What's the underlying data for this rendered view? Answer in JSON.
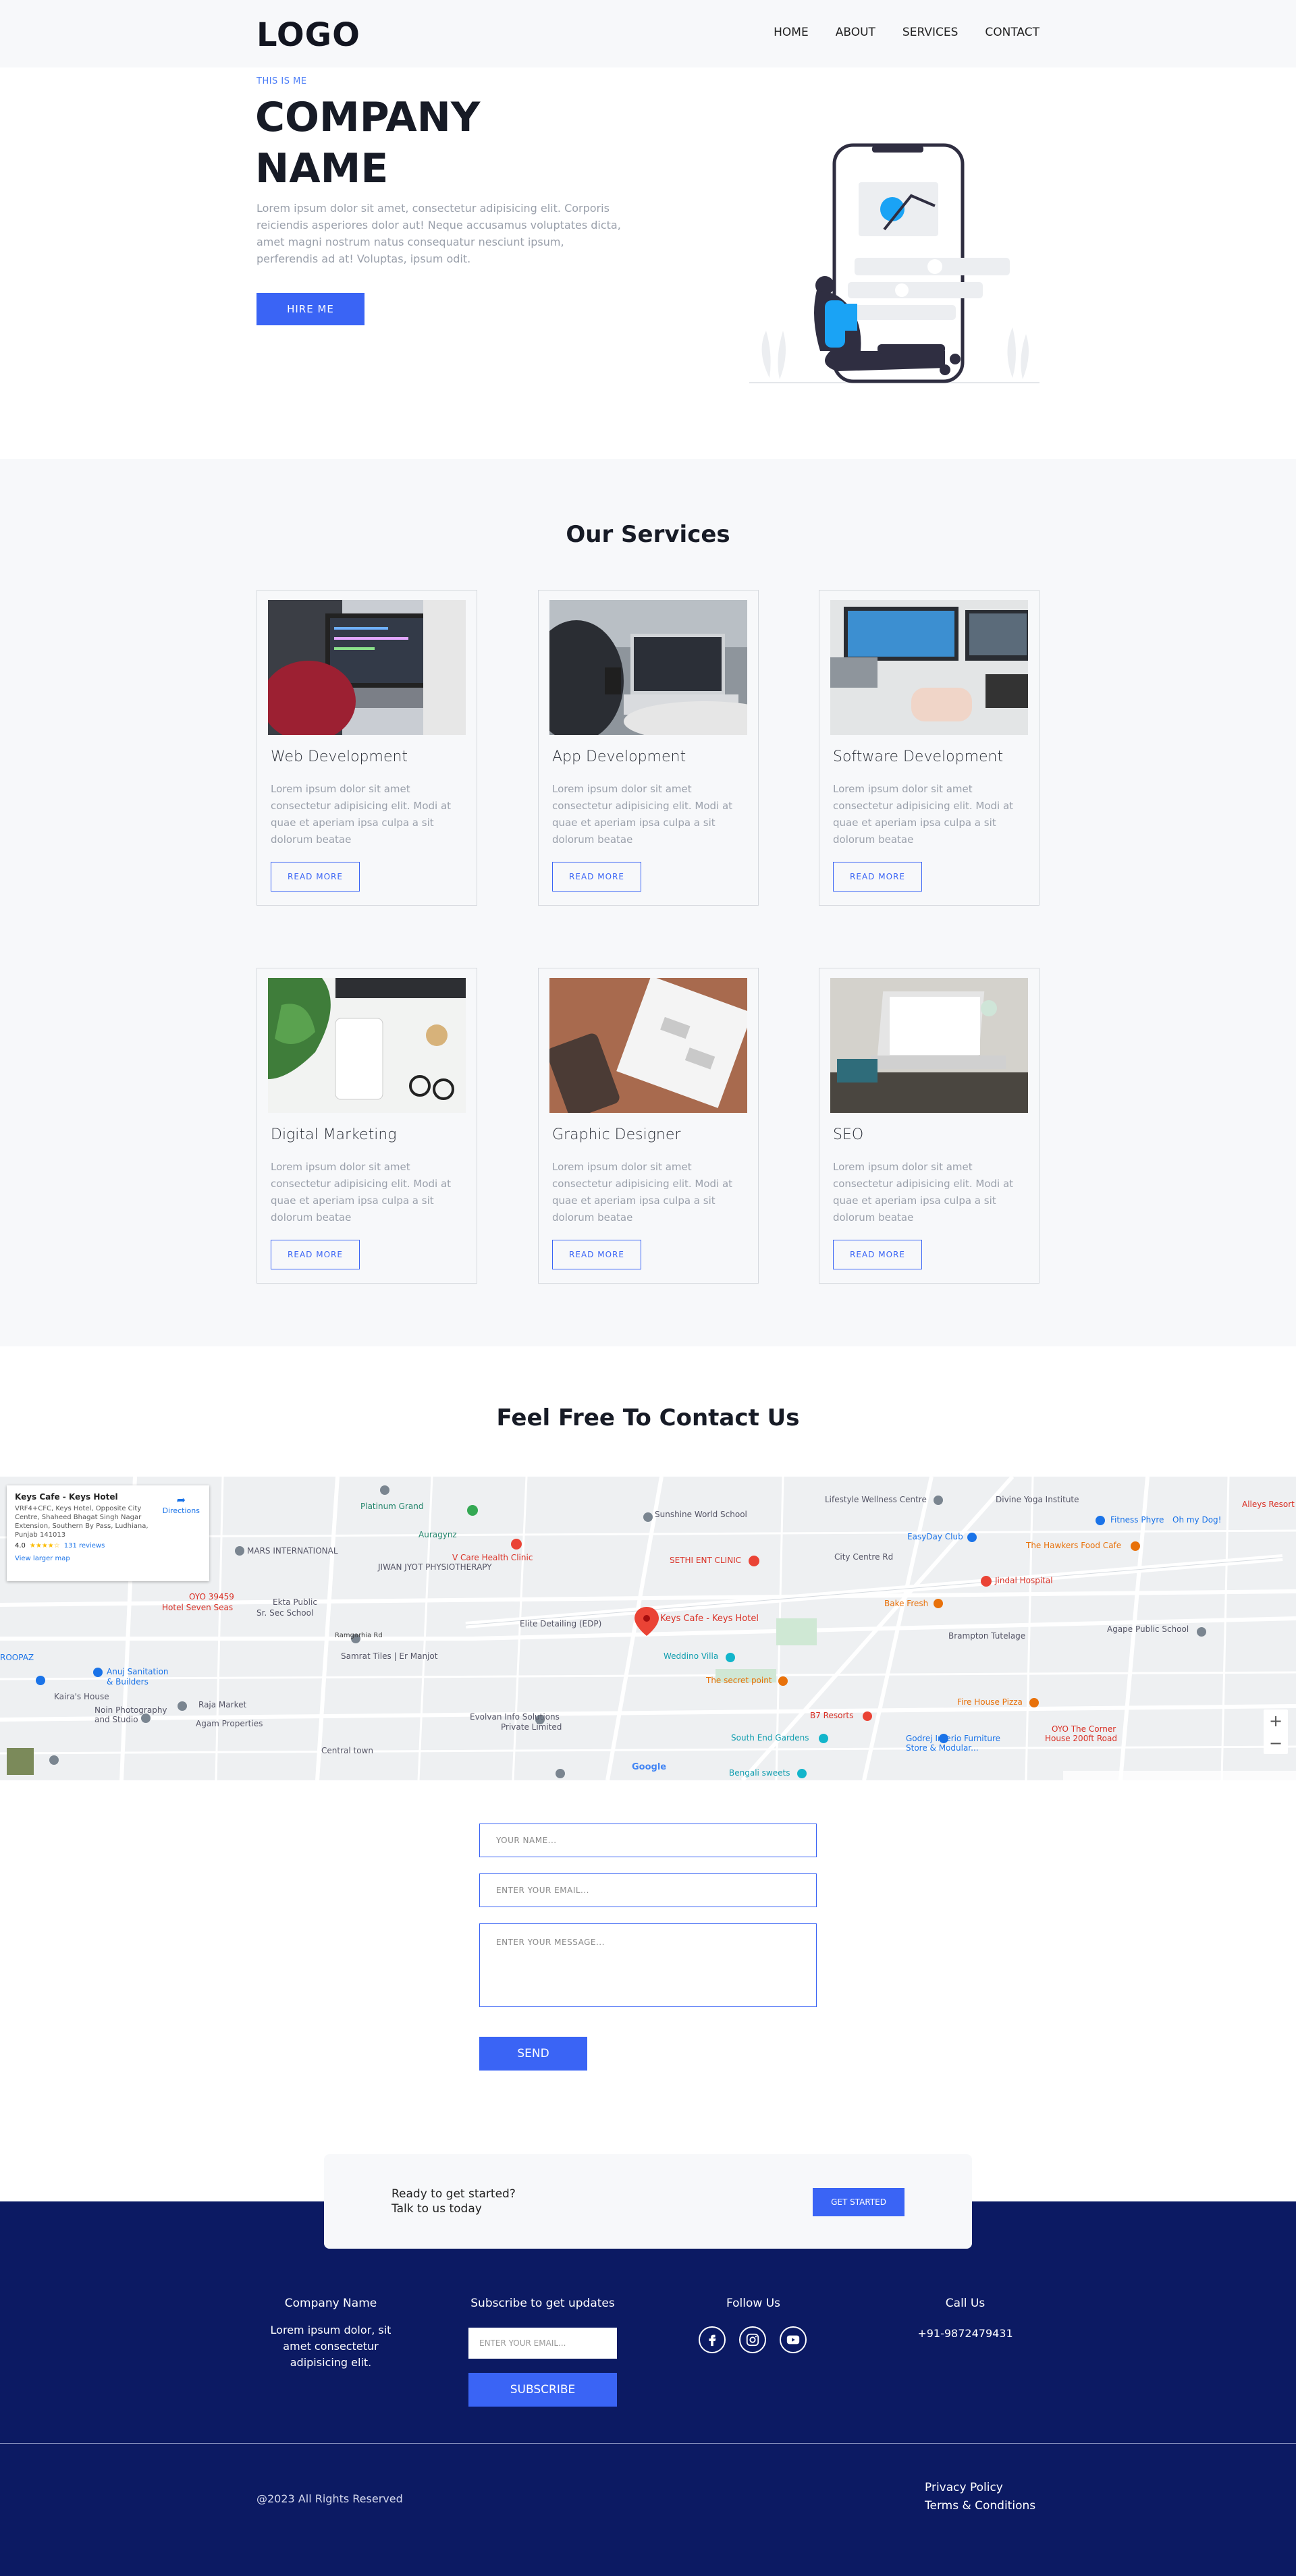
{
  "nav": {
    "logo": "LOGO",
    "items": [
      "HOME",
      "ABOUT",
      "SERVICES",
      "CONTACT"
    ]
  },
  "hero": {
    "eyebrow": "THIS IS ME",
    "title_line1": "COMPANY",
    "title_line2": "NAME",
    "lead": "Lorem ipsum dolor sit amet, consectetur adipisicing elit. Corporis reiciendis asperiores dolor aut! Neque accusamus voluptates dicta, amet magni nostrum natus consequatur nesciunt ipsum, perferendis ad at! Voluptas, ipsum odit.",
    "button": "HIRE ME"
  },
  "services": {
    "title": "Our Services",
    "read_more": "READ MORE",
    "items": [
      {
        "title": "Web Development",
        "desc": "Lorem ipsum dolor sit amet consectetur adipisicing elit. Modi at quae et aperiam ipsa culpa a sit dolorum beatae"
      },
      {
        "title": "App Development",
        "desc": "Lorem ipsum dolor sit amet consectetur adipisicing elit. Modi at quae et aperiam ipsa culpa a sit dolorum beatae"
      },
      {
        "title": "Software Development",
        "desc": "Lorem ipsum dolor sit amet consectetur adipisicing elit. Modi at quae et aperiam ipsa culpa a sit dolorum beatae"
      },
      {
        "title": "Digital Marketing",
        "desc": "Lorem ipsum dolor sit amet consectetur adipisicing elit. Modi at quae et aperiam ipsa culpa a sit dolorum beatae"
      },
      {
        "title": "Graphic Designer",
        "desc": "Lorem ipsum dolor sit amet consectetur adipisicing elit. Modi at quae et aperiam ipsa culpa a sit dolorum beatae"
      },
      {
        "title": "SEO",
        "desc": "Lorem ipsum dolor sit amet consectetur adipisicing elit. Modi at quae et aperiam ipsa culpa a sit dolorum beatae"
      }
    ]
  },
  "contact": {
    "title": "Feel Free To Contact Us",
    "name_placeholder": "YOUR NAME...",
    "email_placeholder": "ENTER YOUR EMAIL...",
    "message_placeholder": "ENTER YOUR MESSAGE...",
    "send": "SEND"
  },
  "map": {
    "place": "Keys Cafe - Keys Hotel",
    "address": "VRF4+CFC, Keys Hotel, Opposite City Centre, Shaheed Bhagat Singh Nagar Extension, Southern By Pass, Ludhiana, Punjab 141013",
    "rating": "4.0",
    "reviews": "131 reviews",
    "directions": "Directions",
    "larger": "View larger map",
    "marker_label": "Keys Cafe - Keys Hotel",
    "labels": [
      "Platinum Grand",
      "Sunshine World School",
      "Lifestyle Wellness Centre",
      "Divine Yoga Institute",
      "Fitness Phyre",
      "Oh my Dog!",
      "Alleys Resort",
      "Auragynz",
      "EasyDay Club",
      "The Hawkers Food Cafe",
      "V Care Health Clinic",
      "SETHI ENT CLINIC",
      "City Centre Rd",
      "MARS INTERNATIONAL",
      "JIWAN JYOT PHYSIOTHERAPY",
      "Jindal Hospital",
      "Bake Fresh",
      "OYO 39459 Hotel Seven Seas",
      "Ekta Public Sr. Sec School",
      "Elite Detailing (EDP)",
      "Brampton Tutelage",
      "Agape Public School",
      "ROOPAZ",
      "Anuj Sanitation & Builders",
      "Samrat Tiles | Er Manjot",
      "Weddino Villa",
      "The secret point",
      "Kaira's House",
      "Raja Market",
      "Agam Properties",
      "Evolvan Info Solutions Private Limited",
      "B7 Resorts",
      "Fire House Pizza",
      "OYO The Corner House 200ft Road",
      "Noin Photography and Studio",
      "Central town",
      "South End Gardens",
      "Godrej Interio Furniture Store & Modular",
      "Bengali sweets",
      "Ramgarhia Rd",
      "Google"
    ]
  },
  "cta": {
    "line1": "Ready to get started?",
    "line2": "Talk to us today",
    "button": "GET STARTED"
  },
  "footer": {
    "company_heading": "Company Name",
    "company_text": "Lorem ipsum dolor, sit amet consectetur adipisicing elit.",
    "subscribe_heading": "Subscribe to get updates",
    "subscribe_placeholder": "ENTER YOUR EMAIL...",
    "subscribe_button": "SUBSCRIBE",
    "follow_heading": "Follow Us",
    "call_heading": "Call Us",
    "phone": "+91-9872479431",
    "copyright": "@2023 All Rights Reserved",
    "privacy": "Privacy Policy",
    "terms": "Terms & Conditions"
  },
  "colors": {
    "accent": "#3a64f5",
    "footer": "#0c1a63",
    "light_bg": "#f7f8fa"
  },
  "icons": [
    "facebook-icon",
    "instagram-icon",
    "youtube-icon",
    "star-icon",
    "map-pin-icon",
    "zoom-in-icon",
    "zoom-out-icon"
  ]
}
